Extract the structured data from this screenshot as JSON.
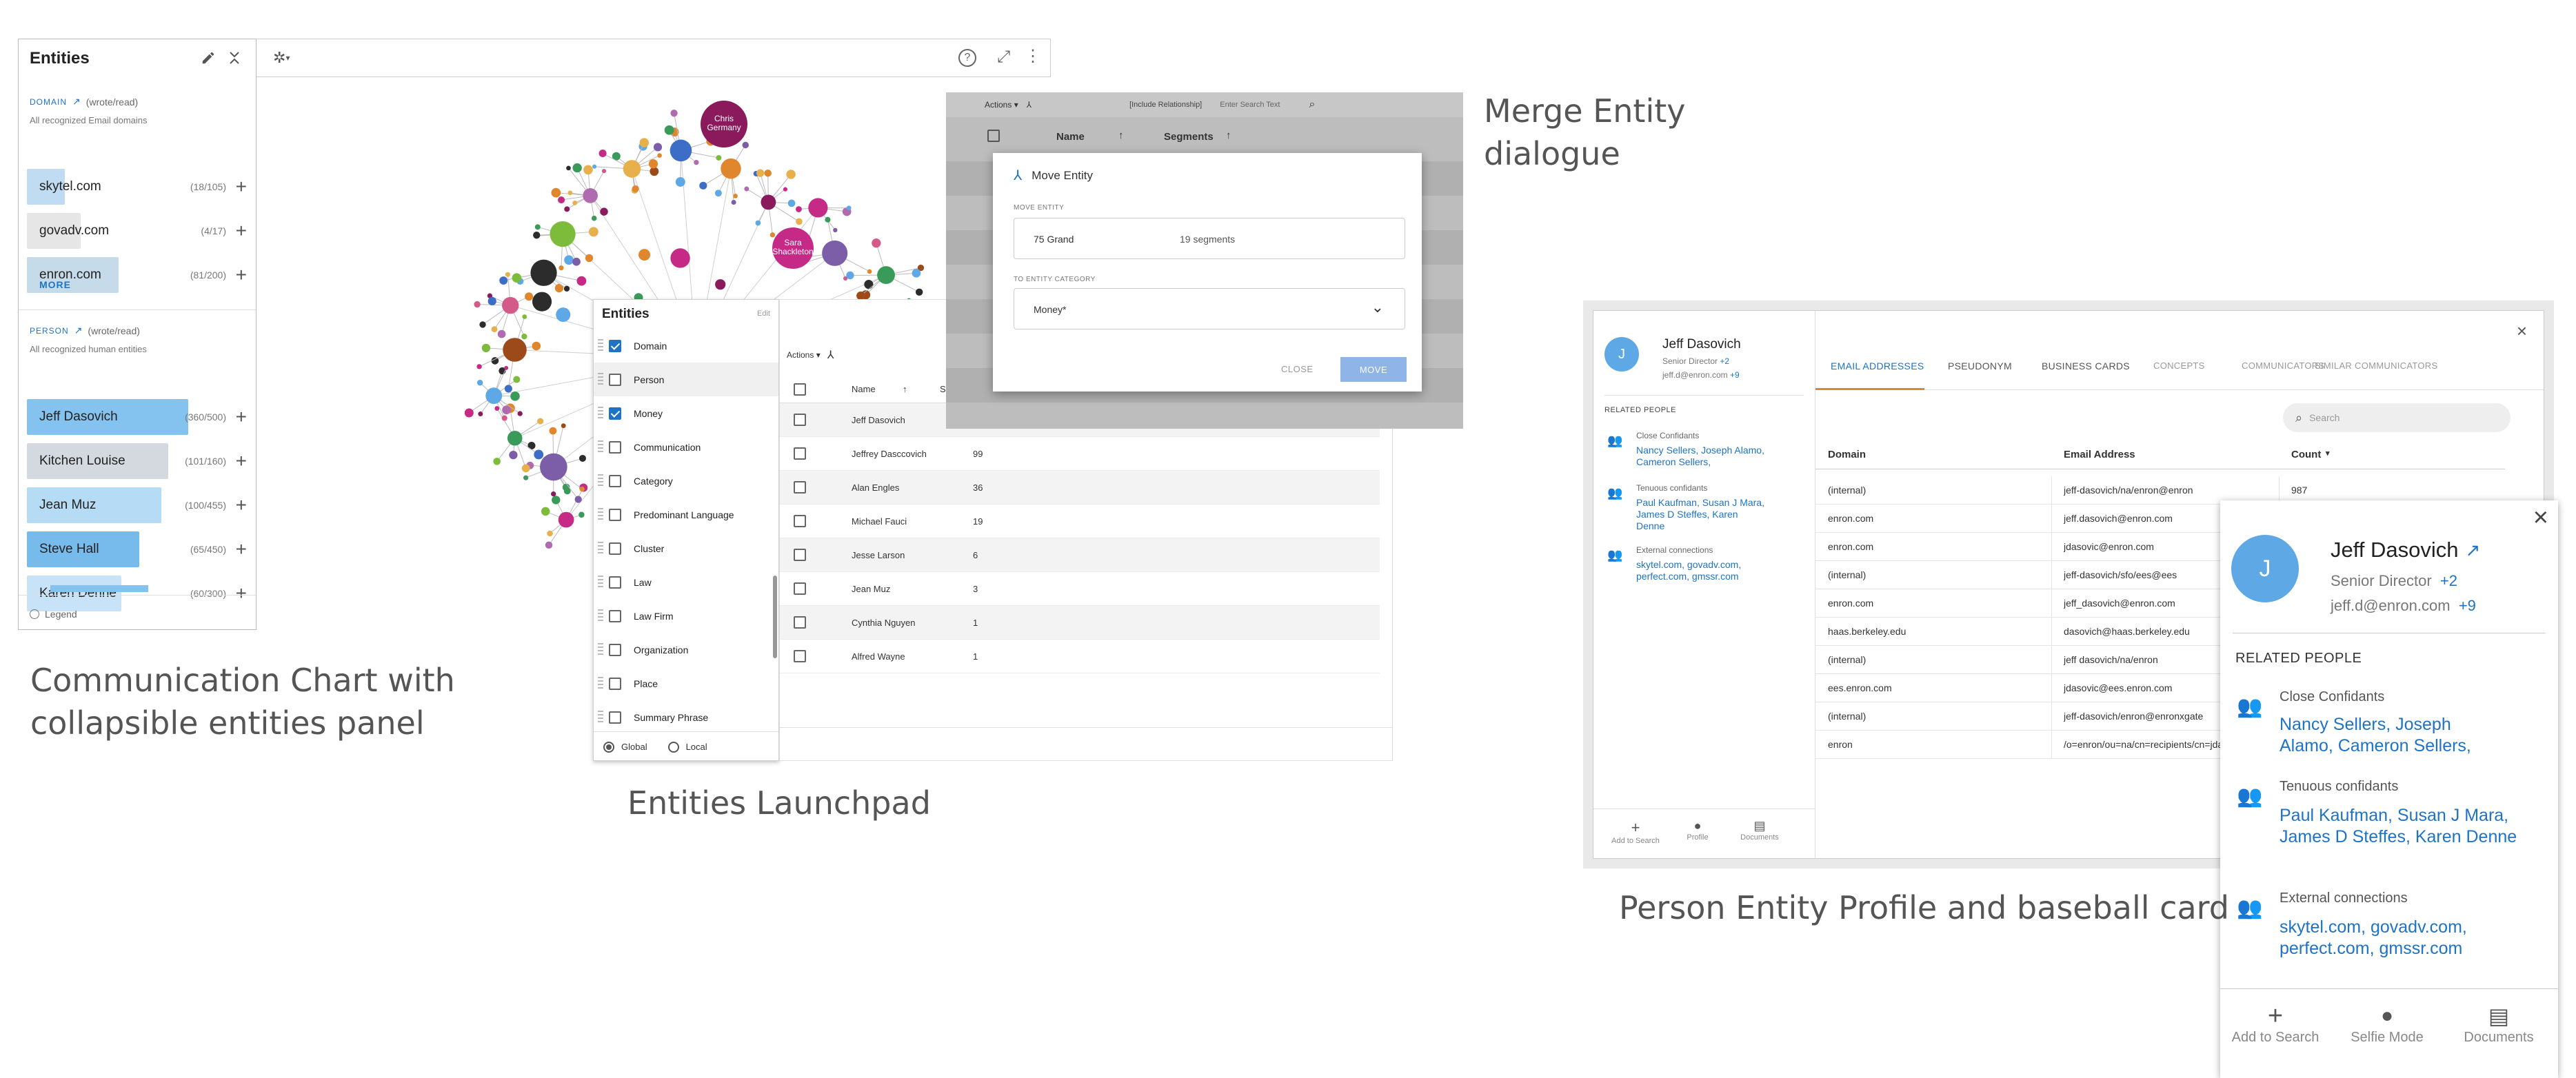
{
  "captions": {
    "comm": [
      "Communication Chart with",
      "collapsible entities panel"
    ],
    "launchpad": "Entities Launchpad",
    "merge": [
      "Merge Entity",
      "dialogue"
    ],
    "profile": "Person Entity Profile and baseball card"
  },
  "entities_panel": {
    "title": "Entities",
    "domain_section": {
      "label": "DOMAIN",
      "mode": "(wrote/read)",
      "subtitle": "All recognized Email domains",
      "more": "MORE"
    },
    "domains": [
      {
        "name": "skytel.com",
        "count": "(18/105)",
        "ratio": 0.17,
        "color": "#bfdcf3"
      },
      {
        "name": "govadv.com",
        "count": "(4/17)",
        "ratio": 0.24,
        "color": "#e6e6e6"
      },
      {
        "name": "enron.com",
        "count": "(81/200)",
        "ratio": 0.41,
        "color": "#c6dbe9"
      }
    ],
    "person_section": {
      "label": "PERSON",
      "mode": "(wrote/read)",
      "subtitle": "All recognized human entities"
    },
    "persons": [
      {
        "name": "Jeff Dasovich",
        "count": "(360/500)",
        "ratio": 0.72,
        "color": "#84c2ef"
      },
      {
        "name": "Kitchen Louise",
        "count": "(101/160)",
        "ratio": 0.63,
        "color": "#d3d9de"
      },
      {
        "name": "Jean Muz",
        "count": "(100/455)",
        "ratio": 0.6,
        "color": "#b5dbf5"
      },
      {
        "name": "Steve Hall",
        "count": "(65/450)",
        "ratio": 0.5,
        "color": "#76bbec"
      },
      {
        "name": "Karen Denne",
        "count": "(60/300)",
        "ratio": 0.42,
        "color": "#c8e3f7"
      }
    ],
    "legend": "Legend"
  },
  "chart": {
    "nodes": [
      {
        "label": "Chris Germany",
        "color": "#8a1a5c"
      },
      {
        "label": "Sara Shackleton",
        "color": "#c42a86"
      }
    ]
  },
  "launchpad": {
    "title": "Entities",
    "edit": "Edit",
    "categories": [
      {
        "label": "Domain",
        "checked": true
      },
      {
        "label": "Person",
        "checked": false
      },
      {
        "label": "Money",
        "checked": true
      },
      {
        "label": "Communication",
        "checked": false
      },
      {
        "label": "Category",
        "checked": false
      },
      {
        "label": "Predominant Language",
        "checked": false
      },
      {
        "label": "Cluster",
        "checked": false
      },
      {
        "label": "Law",
        "checked": false
      },
      {
        "label": "Law Firm",
        "checked": false
      },
      {
        "label": "Organization",
        "checked": false
      },
      {
        "label": "Place",
        "checked": false
      },
      {
        "label": "Summary Phrase",
        "checked": false
      }
    ],
    "scope_global": "Global",
    "scope_local": "Local",
    "actions": "Actions",
    "col_name": "Name",
    "col_seg": "Seg",
    "rows": [
      {
        "name": "Jeff Dasovich",
        "seg": ""
      },
      {
        "name": "Jeffrey Dasccovich",
        "seg": "99"
      },
      {
        "name": "Alan Engles",
        "seg": "36"
      },
      {
        "name": "Michael Fauci",
        "seg": "19"
      },
      {
        "name": "Jesse Larson",
        "seg": "6"
      },
      {
        "name": "Jean Muz",
        "seg": "3"
      },
      {
        "name": "Cynthia  Nguyen",
        "seg": "1"
      },
      {
        "name": "Alfred Wayne",
        "seg": "1"
      }
    ]
  },
  "merge": {
    "actions": "Actions",
    "include": "[Include Relationship]",
    "search_placeholder": "Enter Search Text",
    "col_name": "Name",
    "col_segments": "Segments",
    "dialog_title": "Move Entity",
    "move_entity_label": "MOVE ENTITY",
    "entity_name": "75 Grand",
    "entity_segments": "19 segments",
    "to_category_label": "TO ENTITY CATEGORY",
    "category_value": "Money*",
    "close": "CLOSE",
    "move": "MOVE"
  },
  "profile": {
    "avatar": "J",
    "name": "Jeff Dasovich",
    "role": "Senior Director",
    "role_more": "+2",
    "email": "jeff.d@enron.com",
    "email_more": "+9",
    "related_heading": "RELATED PEOPLE",
    "close_confidants_label": "Close Confidants",
    "close_confidants": "Nancy Sellers, Joseph Alamo, Cameron Sellers,",
    "tenuous_label": "Tenuous confidants",
    "tenuous": "Paul Kaufman, Susan J Mara, James D Steffes, Karen Denne",
    "external_label": "External connections",
    "external": "skytel.com, govadv.com, perfect.com, gmssr.com",
    "footer": [
      "Add to Search",
      "Profile",
      "Documents"
    ],
    "tabs": [
      "EMAIL ADDRESSES",
      "PSEUDONYM",
      "BUSINESS CARDS",
      "CONCEPTS",
      "COMMUNICATORS",
      "SIMILAR COMMUNICATORS"
    ],
    "search_placeholder": "Search",
    "table_headers": [
      "Domain",
      "Email Address",
      "Count"
    ],
    "table_rows": [
      {
        "domain": "(internal)",
        "email": "jeff-dasovich/na/enron@enron",
        "count": "987"
      },
      {
        "domain": "enron.com",
        "email": "jeff.dasovich@enron.com",
        "count": ""
      },
      {
        "domain": "enron.com",
        "email": "jdasovic@enron.com",
        "count": ""
      },
      {
        "domain": "(internal)",
        "email": "jeff-dasovich/sfo/ees@ees",
        "count": ""
      },
      {
        "domain": "enron.com",
        "email": "jeff_dasovich@enron.com",
        "count": ""
      },
      {
        "domain": "haas.berkeley.edu",
        "email": "dasovich@haas.berkeley.edu",
        "count": ""
      },
      {
        "domain": "(internal)",
        "email": "jeff dasovich/na/enron",
        "count": ""
      },
      {
        "domain": "ees.enron.com",
        "email": "jdasovic@ees.enron.com",
        "count": ""
      },
      {
        "domain": "(internal)",
        "email": "jeff-dasovich/enron@enronxgate",
        "count": ""
      },
      {
        "domain": "enron",
        "email": "/o=enron/ou=na/cn=recipients/cn=jdasovic",
        "count": ""
      }
    ]
  },
  "card": {
    "avatar": "J",
    "name": "Jeff Dasovich",
    "role": "Senior Director",
    "role_more": "+2",
    "email": "jeff.d@enron.com",
    "email_more": "+9",
    "related_heading": "RELATED PEOPLE",
    "close_confidants_label": "Close Confidants",
    "close_confidants": "Nancy Sellers, Joseph Alamo, Cameron Sellers,",
    "tenuous_label": "Tenuous confidants",
    "tenuous": "Paul Kaufman, Susan J Mara, James D Steffes, Karen Denne",
    "external_label": "External connections",
    "external": "skytel.com, govadv.com, perfect.com, gmssr.com",
    "footer": [
      "Add to Search",
      "Selfie Mode",
      "Documents"
    ]
  },
  "colors": {
    "accent": "#1e73c4",
    "move_button": "#8fb5e8",
    "tab_active": "#e0862c"
  }
}
